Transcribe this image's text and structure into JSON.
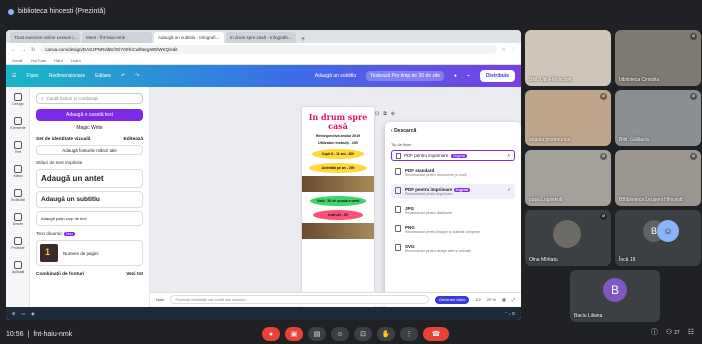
{
  "meet": {
    "title": "biblioteca hincesti (Prezintă)",
    "time": "10:56",
    "meeting_code": "fnt-haiu-nmk",
    "people_count": "27"
  },
  "browser": {
    "tabs": [
      "Trust exercise online Lesson (...",
      "Meet - fht-haiu-nmk",
      "Adaugă un subtitlu - Infografi...",
      "In drum spre casă - Infografic..."
    ],
    "url": "canva.com/design/DAGzPNRvtbE/IGlY0rfKiCwf8eqyWElWKQ/edit",
    "bookmarks": [
      "Gmail",
      "YouTube",
      "Hărți",
      "Learn"
    ]
  },
  "canva": {
    "topbar": {
      "home": "Fișier",
      "resize": "Redimensionare",
      "edit": "Editare",
      "doc_title": "Adaugă un subtitlu",
      "trial": "Testează Pro timp de 30 de zile",
      "share": "Distribuie"
    },
    "rail": [
      "Design",
      "Elemente",
      "Text",
      "Mărci",
      "Încărcări",
      "Desen",
      "Proiecte",
      "Aplicații"
    ],
    "panel": {
      "search_placeholder": "Caută fonturi și combinații",
      "add_text": "Adaugă o casetă text",
      "magic_write": "Magic Write",
      "brand_kit": "Set de identitate vizuală",
      "brand_edit": "Editează",
      "add_brand_fonts": "Adaugă fonturile mărcii tale",
      "default_styles": "Stiluri de text implicite",
      "heading": "Adaugă un antet",
      "subheading": "Adaugă un subtitlu",
      "body": "Adaugă puțin corp de text",
      "dynamic_text": "Text dinamic",
      "new_badge": "Nou",
      "page_numbers": "Numere de pagini",
      "font_combos": "Combinații de fonturi",
      "see_all": "Vezi tot"
    },
    "page": {
      "title_line1": "In drum spre",
      "title_line2": "casă",
      "subtitle": "Retrospectiva anului 2019",
      "subtitle2": "Utilizatori instruiți - 250",
      "ovals": [
        {
          "text": "Copii 6 - 11 ani - 300",
          "color": "#ffd83b"
        },
        {
          "text": "Activități pe an - 290",
          "color": "#ffd83b"
        },
        {
          "text": "Viziți - 50 de școala a venit",
          "color": "#41d46a"
        },
        {
          "text": "Instruiri - 25",
          "color": "#ff4f7b"
        }
      ]
    },
    "download": {
      "back": "Descarcă",
      "type_label": "Tip de fișier",
      "selected": "PDF pentru imprimare",
      "selected_tag": "Sugerat",
      "options": [
        {
          "title": "PDF standard",
          "desc": "Recomandat pentru documente (e-mail)",
          "tag": ""
        },
        {
          "title": "PDF pentru imprimare",
          "desc": "Recomandat pentru imprimare",
          "tag": "Sugerat"
        },
        {
          "title": "JPG",
          "desc": "Recomandat pentru distribuire",
          "tag": ""
        },
        {
          "title": "PNG",
          "desc": "Recomandat pentru imagini și ilustrații complexe",
          "tag": ""
        },
        {
          "title": "SVG",
          "desc": "Recomandat pentru design web și animații",
          "tag": ""
        }
      ]
    },
    "bottom": {
      "notes": "Note",
      "prompt": "Pronunță meditațiile sau schiță sau desenul...",
      "generate": "Generare video",
      "page_count": "1/2",
      "zoom": "29 %"
    }
  },
  "participants": [
    {
      "name": "Bibl. Uțiul-Moscovit",
      "bg": "#cfc5b8"
    },
    {
      "name": "biblioteca Cimișlia",
      "bg": "#7e7a72"
    },
    {
      "name": "angela postoronca",
      "bg": "#bfa58a"
    },
    {
      "name": "Bibl. Gălăuca",
      "bg": "#8b8f93"
    },
    {
      "name": "pușa Logiinkoli",
      "bg": "#a4a09a"
    },
    {
      "name": "BBiblioteca Leușeni Hîncești",
      "bg": "#9a968f"
    },
    {
      "name": "Olna Mîritatu",
      "bg": "#6d6b66"
    },
    {
      "name": "Încă 18",
      "bg": "#3c4043"
    },
    {
      "name": "Baciu Liliana",
      "bg": "#3c4043"
    }
  ],
  "colors": {
    "accent": "#7d2ae8",
    "meet_bg": "#202124",
    "end_call": "#ea4335"
  }
}
